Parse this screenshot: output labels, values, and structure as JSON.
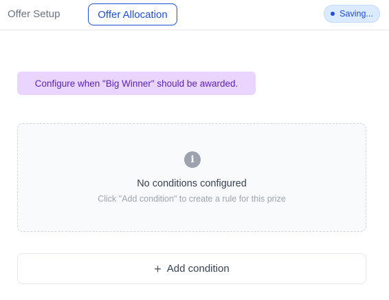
{
  "tabs": [
    {
      "label": "Offer Setup",
      "active": false
    },
    {
      "label": "Offer Allocation",
      "active": true
    }
  ],
  "status": {
    "label": "Saving...",
    "icon": "dot-icon"
  },
  "banner": {
    "text": "Configure when \"Big Winner\" should be awarded."
  },
  "empty_state": {
    "icon": "info-icon",
    "title": "No conditions configured",
    "subtitle": "Click \"Add condition\" to create a rule for this prize"
  },
  "add_button": {
    "label": "Add condition",
    "icon": "plus-icon"
  },
  "colors": {
    "accent": "#1d4ed8",
    "status_bg": "#dbeafe",
    "banner_bg": "#e9d5ff",
    "banner_text": "#5b21b6"
  }
}
